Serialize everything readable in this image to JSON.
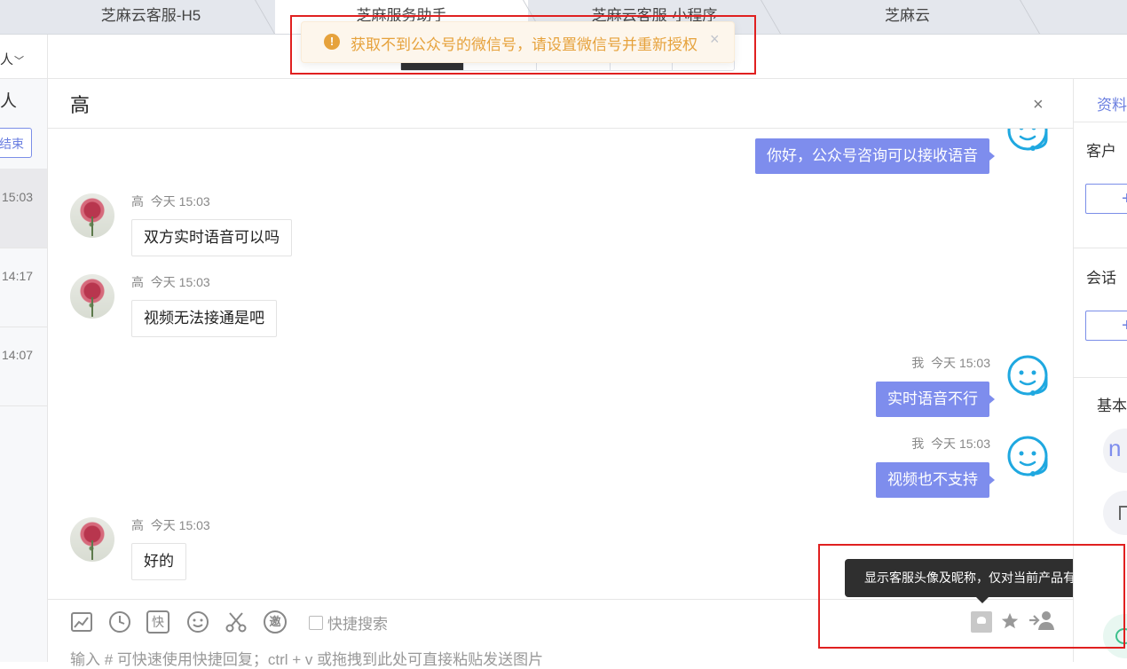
{
  "tabs": [
    {
      "label": "芝麻云客服-H5"
    },
    {
      "label": "芝麻服务助手"
    },
    {
      "label": "芝麻云客服-小程序"
    },
    {
      "label": "芝麻云"
    }
  ],
  "left_panel": {
    "dropdown_label": "人",
    "people_label": "人",
    "end_button": "结束",
    "sessions": [
      {
        "time": "15:03"
      },
      {
        "time": "14:17"
      },
      {
        "time": "14:07"
      }
    ]
  },
  "notification": {
    "text": "获取不到公众号的微信号，请设置微信号并重新授权",
    "close": "×"
  },
  "chat": {
    "title": "高",
    "close": "×",
    "messages": [
      {
        "from": "agent",
        "text": "你好，公众号咨询可以接收语音"
      },
      {
        "from": "customer",
        "name": "高",
        "time": "今天 15:03",
        "text": "双方实时语音可以吗"
      },
      {
        "from": "customer",
        "name": "高",
        "time": "今天 15:03",
        "text": "视频无法接通是吧"
      },
      {
        "from": "agent",
        "name": "我",
        "time": "今天 15:03",
        "text": "实时语音不行"
      },
      {
        "from": "agent",
        "name": "我",
        "time": "今天 15:03",
        "text": "视频也不支持"
      },
      {
        "from": "customer",
        "name": "高",
        "time": "今天 15:03",
        "text": "好的"
      }
    ]
  },
  "input": {
    "quick_search_label": "快捷搜索",
    "placeholder": "输入 # 可快速使用快捷回复；ctrl + v 或拖拽到此处可直接粘贴发送图片",
    "tooltip": "显示客服头像及昵称，仅对当前产品有效。",
    "toolbar_icons": [
      "image-icon",
      "clock-icon",
      "quick-reply-icon",
      "emoji-icon",
      "scissors-icon",
      "invite-icon"
    ],
    "invite_glyph": "邀",
    "quick_glyph": "快"
  },
  "right_panel": {
    "tab": "资料",
    "customer_label": "客户",
    "session_label": "会话",
    "basic_label": "基本",
    "add": "+",
    "avatar_letter": "n"
  },
  "colors": {
    "accent": "#7e8ded",
    "warning": "#e6a23c",
    "highlight_box": "#e02020",
    "agent_icon": "#1fa8e0"
  }
}
